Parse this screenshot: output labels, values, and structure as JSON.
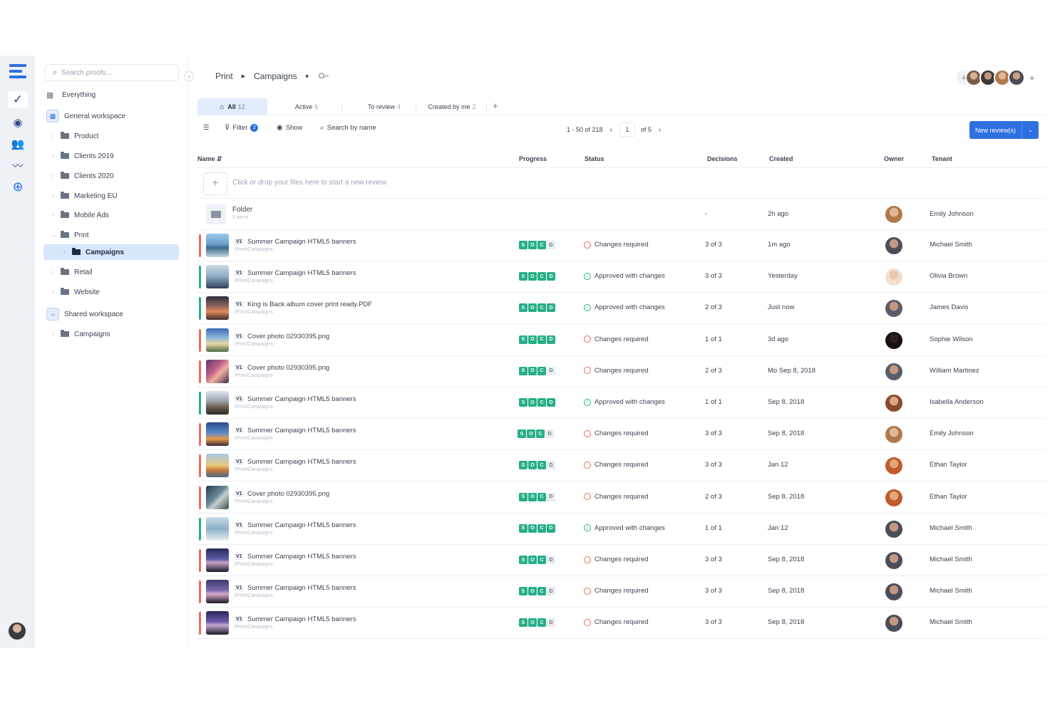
{
  "colors": {
    "accent": "#2f6fe0",
    "success": "#27ae88",
    "warning": "#f0695a",
    "sidebar_selected": "#d7e6fb"
  },
  "rail": {
    "icons": [
      "logo-icon",
      "check-icon",
      "eye-icon",
      "users-icon",
      "activity-icon",
      "plus-circle-icon"
    ]
  },
  "sidebar": {
    "search_placeholder": "Search proofs...",
    "everything": "Everything",
    "general_workspace": "General workspace",
    "folders": [
      "Product",
      "Clients 2019",
      "Clients 2020",
      "Marketing EU",
      "Mobile Ads",
      "Print"
    ],
    "selected_folder": "Campaigns",
    "after_folders": [
      "Retail",
      "Website"
    ],
    "shared_workspace": "Shared workspace",
    "shared_folders": [
      "Campaigns"
    ]
  },
  "header": {
    "breadcrumb": [
      "Print",
      "Campaigns"
    ],
    "shortcut_key": "O",
    "team_more": "4"
  },
  "tabs": [
    {
      "label": "All",
      "count": "12"
    },
    {
      "label": "Active",
      "count": "6"
    },
    {
      "label": "To review",
      "count": "4"
    },
    {
      "label": "Created by me",
      "count": "2"
    }
  ],
  "toolbar": {
    "filter": "Filter",
    "filter_count": "2",
    "show": "Show",
    "search": "Search by name",
    "range": "1 - 50 of 218",
    "page": "1",
    "of_pages": "of 5",
    "new_review": "New review(s)"
  },
  "columns": {
    "name": "Name",
    "progress": "Progress",
    "status": "Status",
    "decisions": "Decisions",
    "created": "Created",
    "owner": "Owner",
    "tenant": "Tenant"
  },
  "drop_text": "Click or drop your files here to start a new review",
  "folder_row": {
    "name": "Folder",
    "sub": "3 items",
    "decisions": "-",
    "created": "2h ago",
    "tenant": "Emily Johnson"
  },
  "rows": [
    {
      "version": "V1",
      "name": "Summer Campaign HTML5 banners",
      "path": "/Print/Campaigns",
      "progress": [
        "S",
        "O",
        "C",
        "D"
      ],
      "progress_done": 3,
      "status": "Changes required",
      "decisions": "3 of 3",
      "created": "1m ago",
      "tenant": "Michael Smith"
    },
    {
      "version": "V1",
      "name": "Summer Campaign HTML5 banners",
      "path": "/Print/Campaigns",
      "progress": [
        "S",
        "O",
        "C",
        "D"
      ],
      "progress_done": 4,
      "status": "Approved with changes",
      "decisions": "3 of 3",
      "created": "Yesterday",
      "tenant": "Olivia Brown"
    },
    {
      "version": "V1",
      "name": "King is Back album cover print ready.PDF",
      "path": "/Print/Campaigns",
      "progress": [
        "S",
        "O",
        "C",
        "D"
      ],
      "progress_done": 4,
      "status": "Approved with changes",
      "decisions": "2 of 3",
      "created": "Just now",
      "tenant": "James Davis"
    },
    {
      "version": "V1",
      "name": "Cover photo 02930395.png",
      "path": "/Print/Campaigns",
      "progress": [
        "S",
        "O",
        "C",
        "D"
      ],
      "progress_done": 4,
      "status": "Changes required",
      "decisions": "1 of 1",
      "created": "3d ago",
      "tenant": "Sophie Wilson"
    },
    {
      "version": "V1",
      "name": "Cover photo 02930395.png",
      "path": "/Print/Campaigns",
      "progress": [
        "S",
        "O",
        "C",
        "D"
      ],
      "progress_done": 3,
      "status": "Changes required",
      "decisions": "2 of 3",
      "created": "Mo Sep 8, 2018",
      "tenant": "William Martinez"
    },
    {
      "version": "V1",
      "name": "Summer Campaign HTML5 banners",
      "path": "/Print/Campaigns",
      "progress": [
        "S",
        "O",
        "C",
        "D"
      ],
      "progress_done": 4,
      "status": "Approved with changes",
      "decisions": "1 of 1",
      "created": "Sep 8, 2018",
      "tenant": "Isabella Anderson"
    },
    {
      "version": "V1",
      "name": "Summer Campaign HTML5 banners",
      "path": "/Print/Campaigns",
      "progress": [
        "S",
        "O",
        "C",
        "D"
      ],
      "progress_done": 3,
      "status": "Changes required",
      "decisions": "3 of 3",
      "created": "Sep 8, 2018",
      "tenant": "Emily Johnson"
    },
    {
      "version": "V1",
      "name": "Summer Campaign HTML5 banners",
      "path": "/Print/Campaigns",
      "progress": [
        "S",
        "O",
        "C",
        "D"
      ],
      "progress_done": 3,
      "status": "Changes required",
      "decisions": "3 of 3",
      "created": "Jan 12",
      "tenant": "Ethan Taylor"
    },
    {
      "version": "V1",
      "name": "Cover photo 02930395.png",
      "path": "/Print/Campaigns",
      "progress": [
        "S",
        "O",
        "C",
        "D"
      ],
      "progress_done": 3,
      "status": "Changes required",
      "decisions": "2 of 3",
      "created": "Sep 8, 2018",
      "tenant": "Ethan Taylor"
    },
    {
      "version": "V1",
      "name": "Summer Campaign HTML5 banners",
      "path": "/Print/Campaigns",
      "progress": [
        "S",
        "O",
        "C",
        "D"
      ],
      "progress_done": 4,
      "status": "Approved with changes",
      "decisions": "1 of 1",
      "created": "Jan 12",
      "tenant": "Michael Smith"
    },
    {
      "version": "V1",
      "name": "Summer Campaign HTML5 banners",
      "path": "/Print/Campaigns",
      "progress": [
        "S",
        "O",
        "C",
        "D"
      ],
      "progress_done": 3,
      "status": "Changes required",
      "decisions": "3 of 3",
      "created": "Sep 8, 2018",
      "tenant": "Michael Smith"
    },
    {
      "version": "V1",
      "name": "Summer Campaign HTML5 banners",
      "path": "/Print/Campaigns",
      "progress": [
        "S",
        "O",
        "C",
        "D"
      ],
      "progress_done": 3,
      "status": "Changes required",
      "decisions": "3 of 3",
      "created": "Sep 8, 2018",
      "tenant": "Michael Smith"
    },
    {
      "version": "V1",
      "name": "Summer Campaign HTML5 banners",
      "path": "/Print/Campaigns",
      "progress": [
        "S",
        "O",
        "C",
        "D"
      ],
      "progress_done": 3,
      "status": "Changes required",
      "decisions": "3 of 3",
      "created": "Sep 8, 2018",
      "tenant": "Michael Smith"
    }
  ]
}
